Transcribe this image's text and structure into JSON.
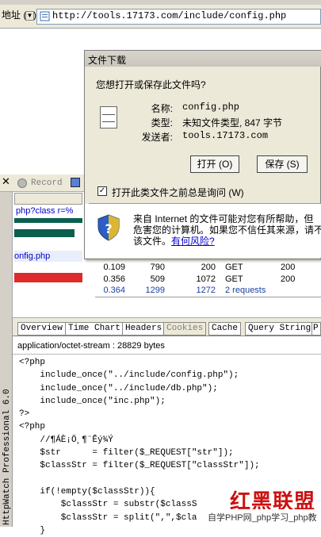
{
  "browser": {
    "address_label": "地址 (D)",
    "url": "http://tools.17173.com/include/config.php"
  },
  "httpwatch": {
    "record_label": "Record",
    "side_title": "HttpWatch Professional 6.0",
    "url_fragment_1": "php?class r=%",
    "url_fragment_2": "onfig.php",
    "rows": [
      {
        "time": "0.109",
        "recv": "790",
        "size": "200",
        "method": "GET",
        "result": "200"
      },
      {
        "time": "0.356",
        "recv": "509",
        "size": "1072",
        "method": "GET",
        "result": "200"
      },
      {
        "time": "0.364",
        "recv": "1299",
        "size": "1272",
        "method": "2 requests",
        "result": ""
      }
    ],
    "tabs": [
      "Overview",
      "Time Chart",
      "Headers",
      "Cookies",
      "Cache",
      "Query String",
      "P"
    ],
    "mime_info": "application/octet-stream : 28829 bytes",
    "code_lines": [
      "<?php",
      "    include_once(\"../include/config.php\");",
      "    include_once(\"../include/db.php\");",
      "    include_once(\"inc.php\");",
      "?>",
      "<?php",
      "    //¶ÁÈ¡Ö¸¶¨Êý¾Ý",
      "    $str      = filter($_REQUEST[\"str\"]);",
      "    $classStr = filter($_REQUEST[\"classStr\"]);",
      "",
      "    if(!empty($classStr)){",
      "        $classStr = substr($classS",
      "        $classStr = split(\",\",$cla",
      "    }"
    ]
  },
  "dialog": {
    "title": "文件下载",
    "question": "您想打开或保存此文件吗?",
    "name_label": "名称:",
    "name_value": "config.php",
    "type_label": "类型:",
    "type_value": "未知文件类型, 847 字节",
    "from_label": "发送者:",
    "from_value": "tools.17173.com",
    "open_button": "打开 (O)",
    "save_button": "保存 (S)",
    "ask_checkbox": "打开此类文件之前总是询问 (W)",
    "ask_checked": true,
    "warning_line1": "来自 Internet 的文件可能对您有所帮助，但",
    "warning_line2": "危害您的计算机。如果您不信任其来源，请不",
    "warning_line3_prefix": "该文件。",
    "risk_link": "有何风险?"
  },
  "watermark": {
    "logo_text": "红黑联盟",
    "site_text": "自学PHP网_php学习_php教"
  }
}
